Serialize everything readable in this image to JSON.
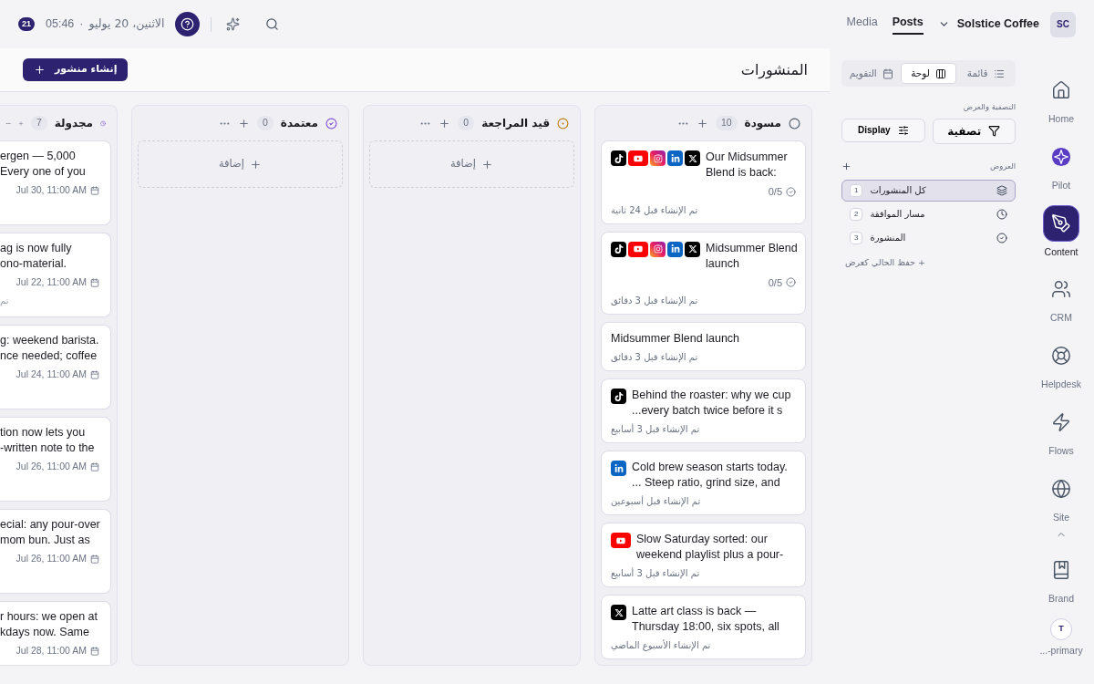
{
  "topbar": {
    "notification_count": "21",
    "date": "الاثنين، 20 يوليو",
    "separator": "·",
    "time": "05:46",
    "tabs": [
      {
        "label": "Posts",
        "selected": true
      },
      {
        "label": "Media",
        "selected": false
      }
    ],
    "workspace": "Solstice Coffee",
    "avatar": "SC"
  },
  "header": {
    "title": "المنشورات",
    "create_button": "إنشاء منشور"
  },
  "columns": [
    {
      "kind": "draft",
      "title": "مسودة",
      "count": "10",
      "posts": [
        {
          "platforms": [
            {
              "kind": "tiktok"
            },
            {
              "kind": "youtube"
            },
            {
              "kind": "instagram"
            },
            {
              "kind": "linkedin"
            },
            {
              "kind": "x"
            }
          ],
          "title_lines": [
            "Our Midsummer",
            "Blend is back:"
          ],
          "progress": "0/5",
          "created": "تم الإنشاء قبل 24 ثانية"
        },
        {
          "platforms": [
            {
              "kind": "tiktok"
            },
            {
              "kind": "youtube"
            },
            {
              "kind": "instagram"
            },
            {
              "kind": "linkedin"
            },
            {
              "kind": "x"
            }
          ],
          "title_lines": [
            "Midsummer Blend",
            "launch"
          ],
          "progress": "0/5",
          "created": "تم الإنشاء قبل 3 دقائق"
        },
        {
          "title_lines": [
            "Midsummer Blend launch"
          ],
          "created": "تم الإنشاء قبل 3 دقائق"
        },
        {
          "platforms": [
            {
              "kind": "tiktok"
            }
          ],
          "title_lines": [
            "Behind the roaster: why we cup",
            "...every batch twice before it s"
          ],
          "created": "تم الإنشاء قبل 3 أسابيع"
        },
        {
          "platforms": [
            {
              "kind": "linkedin"
            }
          ],
          "title_lines": [
            "Cold brew season starts today.",
            "... Steep ratio, grind size, and"
          ],
          "created": "تم الإنشاء قبل أسبوعين"
        },
        {
          "platforms": [
            {
              "kind": "youtube"
            }
          ],
          "title_lines": [
            "Slow Saturday sorted: our",
            "weekend playlist plus a pour-"
          ],
          "created": "تم الإنشاء قبل 3 أسابيع"
        },
        {
          "platforms": [
            {
              "kind": "x"
            }
          ],
          "title_lines": [
            "Latte art class is back —",
            "Thursday 18:00, six spots, all"
          ],
          "created": "تم الإنشاء الأسبوع الماضي"
        }
      ]
    },
    {
      "kind": "review",
      "title": "قيد المراجعة",
      "count": "0",
      "add_label": "إضافة"
    },
    {
      "kind": "approved",
      "title": "معتمدة",
      "count": "0",
      "add_label": "إضافة"
    },
    {
      "kind": "scheduled",
      "title": "مجدولة",
      "count": "7",
      "posts": [
        {
          "title_lines": [
            "ergen — 5,000",
            "Every one of you"
          ],
          "date": "Jul 30, 11:00 AM"
        },
        {
          "title_lines": [
            "ag is now fully",
            "ono-material."
          ],
          "date": "Jul 22, 11:00 AM",
          "created": "تم"
        },
        {
          "title_lines": [
            "g: weekend barista.",
            "nce needed; coffee"
          ],
          "date": "Jul 24, 11:00 AM"
        },
        {
          "title_lines": [
            "tion now lets you",
            "-written note to the"
          ],
          "date": "Jul 26, 11:00 AM"
        },
        {
          "title_lines": [
            "ecial: any pour-over",
            "mom bun. Just as"
          ],
          "date": "Jul 26, 11:00 AM"
        },
        {
          "title_lines": [
            "r hours: we open at",
            "kdays now. Same"
          ],
          "date": "Jul 28, 11:00 AM"
        }
      ]
    }
  ],
  "side_panel": {
    "view_tabs": [
      {
        "kind": "list",
        "label": "قائمة",
        "selected": false
      },
      {
        "kind": "board",
        "label": "لوحة",
        "selected": true
      },
      {
        "kind": "calendar",
        "label": "التقويم",
        "selected": false
      }
    ],
    "filter_label": "التصفية والعرض",
    "filter_button": "تصفية",
    "display_button": "Display",
    "views_label": "العروض",
    "views": [
      {
        "kind": "layers",
        "label": "كل المنشورات",
        "count": "1",
        "selected": true
      },
      {
        "kind": "clock",
        "label": "مسار الموافقة",
        "count": "2",
        "selected": false
      },
      {
        "kind": "check",
        "label": "المنشورة",
        "count": "3",
        "selected": false
      }
    ],
    "save_view": "+ حفظ الحالي كعرض"
  },
  "nav": {
    "items": [
      {
        "kind": "home",
        "label": "Home",
        "selected": false
      },
      {
        "kind": "pilot",
        "label": "Pilot",
        "selected": false
      },
      {
        "kind": "content",
        "label": "Content",
        "selected": true
      },
      {
        "kind": "crm",
        "label": "CRM",
        "selected": false
      },
      {
        "kind": "helpdesk",
        "label": "Helpdesk",
        "selected": false
      },
      {
        "kind": "flows",
        "label": "Flows",
        "selected": false
      },
      {
        "kind": "site",
        "label": "Site",
        "selected": false
      }
    ],
    "bottom_items": [
      {
        "kind": "brand",
        "label": "Brand",
        "selected": false
      }
    ],
    "user": {
      "initial": "T",
      "label": "...-primary"
    }
  }
}
